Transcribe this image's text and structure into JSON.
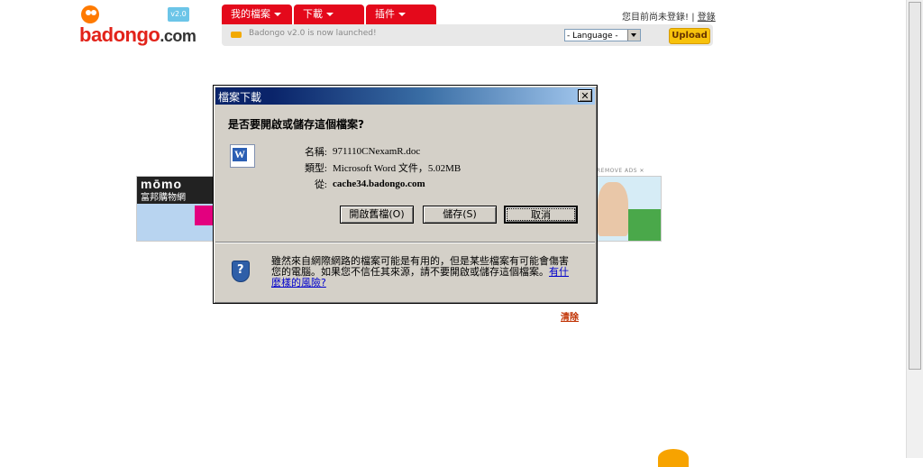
{
  "site": {
    "logo": {
      "main": "badongo",
      "suffix": ".com",
      "version": "v2.0"
    },
    "nav": [
      {
        "label": "我的檔案"
      },
      {
        "label": "下載"
      },
      {
        "label": "插件"
      }
    ],
    "user_status": "您目前尚未登錄!",
    "login_link": "登錄",
    "announcement": "Badongo v2.0 is now launched!",
    "language_select": "- Language -",
    "upload_button": "Upload",
    "clear_link": "清除",
    "remove_ads": "REMOVE ADS ✕"
  },
  "ads": {
    "left": {
      "brand": "mōmo",
      "subtitle": "富邦購物網"
    }
  },
  "dialog": {
    "title": "檔案下載",
    "question": "是否要開啟或儲存這個檔案?",
    "file": {
      "name_label": "名稱:",
      "name": "971110CNexamR.doc",
      "type_label": "類型:",
      "type": "Microsoft Word 文件，5.02MB",
      "from_label": "從:",
      "from": "cache34.badongo.com"
    },
    "buttons": {
      "open": "開啟舊檔(O)",
      "save": "儲存(S)",
      "cancel": "取消"
    },
    "warning_text": "雖然來自網際網路的檔案可能是有用的，但是某些檔案有可能會傷害您的電腦。如果您不信任其來源，請不要開啟或儲存這個檔案。",
    "risk_link": "有什麼樣的風險?"
  }
}
